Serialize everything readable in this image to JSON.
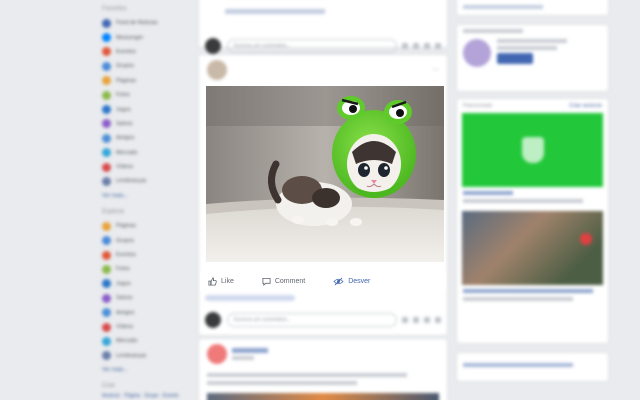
{
  "left_nav": {
    "heading_favorites": "Favoritos",
    "items": [
      {
        "label": "Feed de Notícias",
        "color": "#4267b2",
        "count": ""
      },
      {
        "label": "Messenger",
        "color": "#0084ff",
        "count": ""
      },
      {
        "label": "Eventos",
        "color": "#e0583a",
        "count": ""
      },
      {
        "label": "Grupos",
        "color": "#4a8ad8",
        "count": ""
      },
      {
        "label": "Páginas",
        "color": "#e8a23a",
        "count": ""
      },
      {
        "label": "Fotos",
        "color": "#8bb84a",
        "count": ""
      },
      {
        "label": "Jogos",
        "color": "#2c75c8",
        "count": ""
      },
      {
        "label": "Salvos",
        "color": "#8a5cc8",
        "count": ""
      },
      {
        "label": "Amigos",
        "color": "#4d8fd6",
        "count": ""
      },
      {
        "label": "Mercado",
        "color": "#35a5d8",
        "count": ""
      },
      {
        "label": "Vídeos",
        "color": "#d84a4a",
        "count": ""
      },
      {
        "label": "Lembranças",
        "color": "#6b7ea8",
        "count": ""
      }
    ],
    "see_more": "Ver mais...",
    "heading_explore": "Explorar",
    "explore_items": [
      {
        "label": "Páginas",
        "color": "#e8a23a"
      },
      {
        "label": "Grupos",
        "color": "#4a8ad8"
      },
      {
        "label": "Eventos",
        "color": "#e0583a"
      },
      {
        "label": "Fotos",
        "color": "#8bb84a"
      },
      {
        "label": "Jogos",
        "color": "#2c75c8"
      },
      {
        "label": "Salvos",
        "color": "#8a5cc8"
      },
      {
        "label": "Amigos",
        "color": "#4d8fd6"
      },
      {
        "label": "Vídeos",
        "color": "#d84a4a"
      },
      {
        "label": "Mercado",
        "color": "#35a5d8"
      },
      {
        "label": "Lembranças",
        "color": "#6b7ea8"
      }
    ],
    "see_more_2": "Ver mais...",
    "heading_create": "Criar",
    "create_links": "Anúncio · Página · Grupo · Evento"
  },
  "comment_placeholder": "Escreva um comentário...",
  "post": {
    "author": "",
    "meta": ""
  },
  "actions": {
    "like": "Like",
    "comment": "Comment",
    "unsee": "Desver"
  },
  "right": {
    "sponsored": "Patrocinado",
    "create_ad": "Criar anúncio"
  },
  "colors": {
    "brand": "#4267b2",
    "ad_green": "#22c83a"
  }
}
